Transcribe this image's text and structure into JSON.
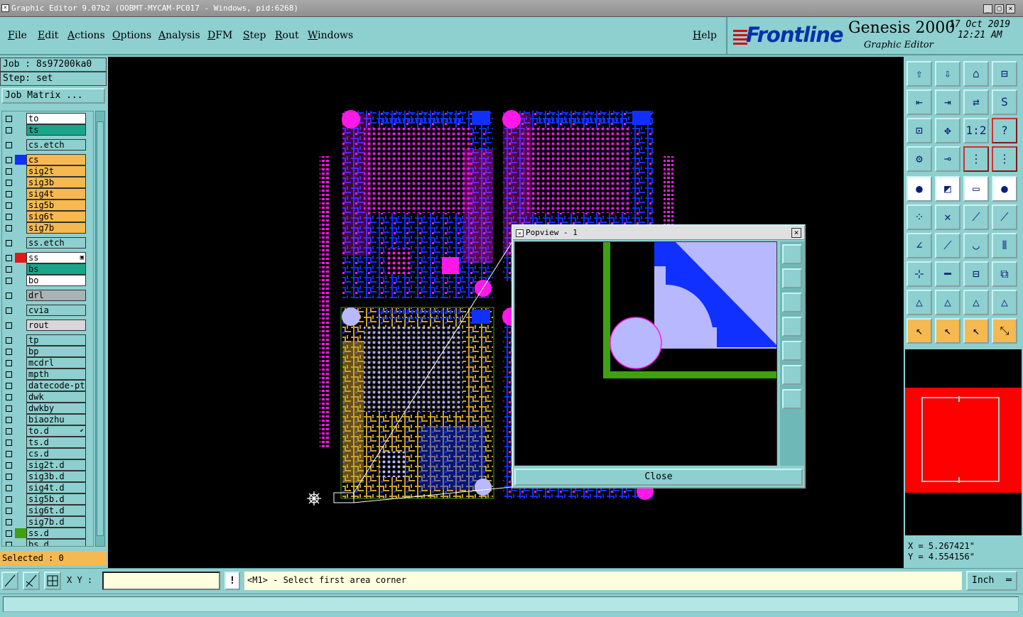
{
  "window": {
    "title": "Graphic Editor 9.07b2 (OOBMT-MYCAM-PC017 - Windows, pid:6268)",
    "buttons": [
      "_",
      "□",
      "×"
    ]
  },
  "menu": {
    "items": [
      "File",
      "Edit",
      "Actions",
      "Options",
      "Analysis",
      "DFM",
      "Step",
      "Rout",
      "Windows"
    ],
    "help": "Help"
  },
  "brand": {
    "logo": "Frontline",
    "product": "Genesis 2000",
    "subtitle": "Graphic Editor",
    "date": "17 Oct 2019",
    "time": "12:21 AM"
  },
  "job": {
    "job_label": "Job : 8s97200ka0",
    "step_label": "Step: set",
    "job_matrix": "Job Matrix ..."
  },
  "layers": [
    {
      "name": "to",
      "swatch": "",
      "bg": "#ffffff"
    },
    {
      "name": "ts",
      "swatch": "",
      "bg": "#1aa58a"
    },
    {
      "name": "cs.etch",
      "swatch": "",
      "bg": "#8ecfcf",
      "gap": true
    },
    {
      "name": "cs",
      "swatch": "#1030ff",
      "bg": "#f5b94f",
      "gap": true
    },
    {
      "name": "sig2t",
      "swatch": "",
      "bg": "#f5b94f"
    },
    {
      "name": "sig3b",
      "swatch": "",
      "bg": "#f5b94f"
    },
    {
      "name": "sig4t",
      "swatch": "",
      "bg": "#f5b94f"
    },
    {
      "name": "sig5b",
      "swatch": "",
      "bg": "#f5b94f"
    },
    {
      "name": "sig6t",
      "swatch": "",
      "bg": "#f5b94f"
    },
    {
      "name": "sig7b",
      "swatch": "",
      "bg": "#f5b94f"
    },
    {
      "name": "ss.etch",
      "swatch": "",
      "bg": "#8ecfcf",
      "gap": true
    },
    {
      "name": "ss",
      "swatch": "#e01818",
      "bg": "#ffffff",
      "gap": true,
      "mark": "▣"
    },
    {
      "name": "bs",
      "swatch": "",
      "bg": "#1aa58a"
    },
    {
      "name": "bo",
      "swatch": "",
      "bg": "#ffffff"
    },
    {
      "name": "drl",
      "swatch": "",
      "bg": "#a8b4b4",
      "gap": true
    },
    {
      "name": "cvia",
      "swatch": "",
      "bg": "#8ecfcf",
      "gap": true
    },
    {
      "name": "rout",
      "swatch": "",
      "bg": "#d8d8d8",
      "gap": true
    },
    {
      "name": "tp",
      "swatch": "",
      "bg": "#8ecfcf",
      "gap": true
    },
    {
      "name": "bp",
      "swatch": "",
      "bg": "#8ecfcf"
    },
    {
      "name": "mcdrl",
      "swatch": "",
      "bg": "#8ecfcf"
    },
    {
      "name": "mpth",
      "swatch": "",
      "bg": "#8ecfcf"
    },
    {
      "name": "datecode-pt",
      "swatch": "",
      "bg": "#8ecfcf"
    },
    {
      "name": "dwk",
      "swatch": "",
      "bg": "#8ecfcf"
    },
    {
      "name": "dwkby",
      "swatch": "",
      "bg": "#8ecfcf"
    },
    {
      "name": "biaozhu",
      "swatch": "",
      "bg": "#8ecfcf"
    },
    {
      "name": "to.d",
      "swatch": "",
      "bg": "#8ecfcf",
      "mark": "⬋"
    },
    {
      "name": "ts.d",
      "swatch": "",
      "bg": "#8ecfcf"
    },
    {
      "name": "cs.d",
      "swatch": "",
      "bg": "#8ecfcf"
    },
    {
      "name": "sig2t.d",
      "swatch": "",
      "bg": "#8ecfcf"
    },
    {
      "name": "sig3b.d",
      "swatch": "",
      "bg": "#8ecfcf"
    },
    {
      "name": "sig4t.d",
      "swatch": "",
      "bg": "#8ecfcf"
    },
    {
      "name": "sig5b.d",
      "swatch": "",
      "bg": "#8ecfcf"
    },
    {
      "name": "sig6t.d",
      "swatch": "",
      "bg": "#8ecfcf"
    },
    {
      "name": "sig7b.d",
      "swatch": "",
      "bg": "#8ecfcf"
    },
    {
      "name": "ss.d",
      "swatch": "#3fa010",
      "bg": "#8ecfcf"
    },
    {
      "name": "bs.d",
      "swatch": "",
      "bg": "#8ecfcf"
    }
  ],
  "selected": "Selected : 0",
  "popview": {
    "title": "Popview - 1",
    "close": "Close"
  },
  "coords": {
    "x": "X = 5.267421\"",
    "y": "Y = 4.554156\""
  },
  "bottom": {
    "xy_label": "X Y :",
    "xy_value": "",
    "message": "<M1> - Select first area corner",
    "msg_icon": "!",
    "unit": "Inch"
  },
  "colors": {
    "canvas": "#000000",
    "pad_magenta": "#ff18e8",
    "trace_blue": "#1030ff",
    "copper_gold": "#c8a030",
    "outline_green": "#3fa010",
    "fill_lavender": "#b8b8ff",
    "overview_red": "#ff0000"
  }
}
